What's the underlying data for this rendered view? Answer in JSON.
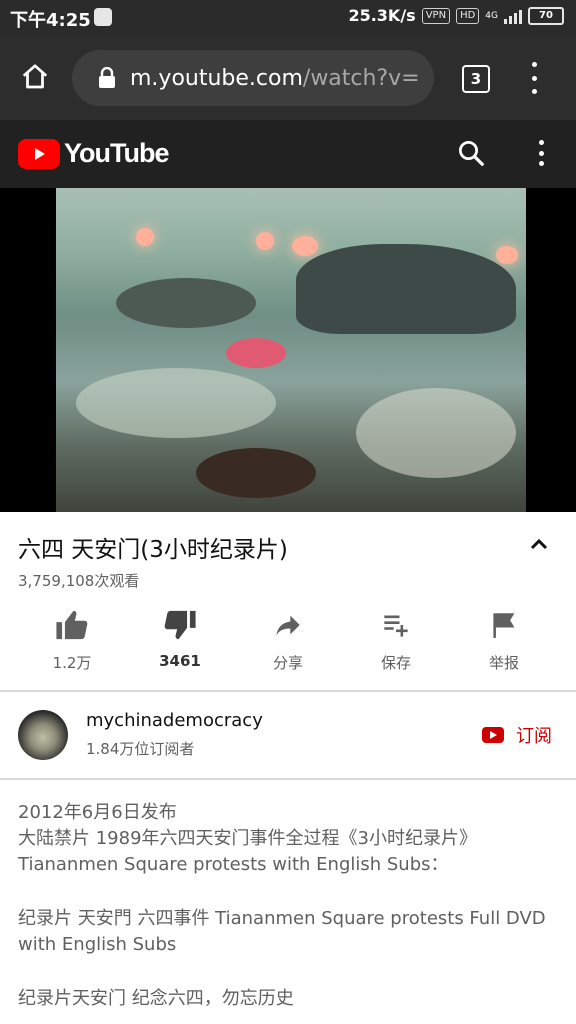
{
  "status_bar": {
    "time": "下午4:25",
    "speed": "25.3K/s",
    "vpn": "VPN",
    "hd": "HD",
    "network": "4G",
    "battery": "70"
  },
  "browser": {
    "url_host": "m.youtube.com",
    "url_rest": "/watch?v=",
    "tab_count": "3"
  },
  "youtube_header": {
    "logo_text": "YouTube"
  },
  "video": {
    "title": "六四 天安门(3小时纪录片)",
    "views": "3,759,108次观看"
  },
  "actions": [
    {
      "label": "1.2万",
      "icon": "thumbs-up-icon"
    },
    {
      "label": "3461",
      "icon": "thumbs-down-icon"
    },
    {
      "label": "分享",
      "icon": "share-icon"
    },
    {
      "label": "保存",
      "icon": "playlist-add-icon"
    },
    {
      "label": "举报",
      "icon": "flag-icon"
    }
  ],
  "channel": {
    "name": "mychinademocracy",
    "subscribers": "1.84万位订阅者",
    "subscribe_label": "订阅"
  },
  "description": {
    "published": "2012年6月6日发布",
    "line1": "大陆禁片 1989年六四天安门事件全过程《3小时纪录片》",
    "line2": "Tiananmen Square protests with English Subs：",
    "line3": "纪录片 天安門 六四事件 Tiananmen Square protests Full DVD with English Subs",
    "line4": "纪录片天安门 纪念六四，勿忘历史"
  },
  "colors": {
    "brand_red": "#ff0000",
    "subscribe_red": "#cc0000",
    "header_bg": "#212121"
  }
}
